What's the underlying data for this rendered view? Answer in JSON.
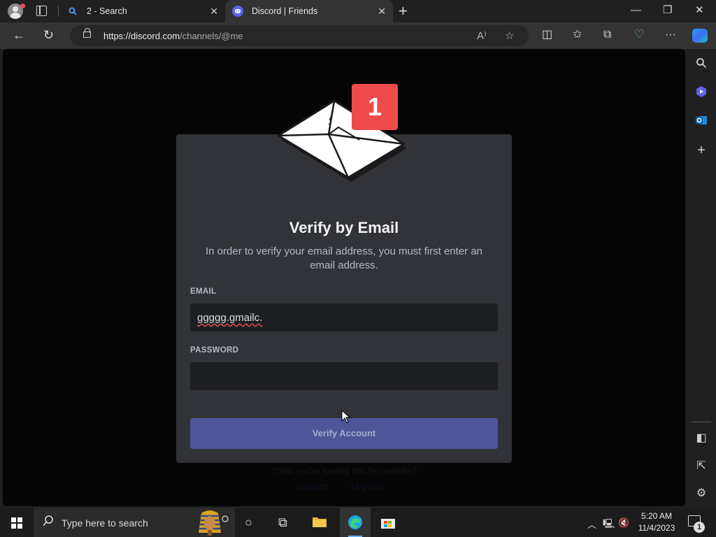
{
  "browser": {
    "tabs": [
      {
        "label": "2 - Search",
        "icon": "search-icon"
      },
      {
        "label": "Discord | Friends",
        "icon": "discord-icon",
        "active": true
      }
    ],
    "url_host": "https://discord.com",
    "url_path": "/channels/@me",
    "read_aloud_label": "A⁾"
  },
  "modal": {
    "badge_count": "1",
    "title": "Verify by Email",
    "description": "In order to verify your email address, you must first enter an email address.",
    "email_label": "EMAIL",
    "email_value": "ggggg.gmailc.",
    "password_label": "PASSWORD",
    "password_value": "",
    "verify_button": "Verify Account"
  },
  "background_text": {
    "line1": "Think you're seeing this by mistake?",
    "line2_a": "Support",
    "line2_b": "Log Out"
  },
  "taskbar": {
    "search_placeholder": "Type here to search",
    "time": "5:20 AM",
    "date": "11/4/2023",
    "notification_count": "1"
  },
  "colors": {
    "accent": "#5865f2",
    "badge": "#f04b4b",
    "modal_bg": "#313338"
  }
}
